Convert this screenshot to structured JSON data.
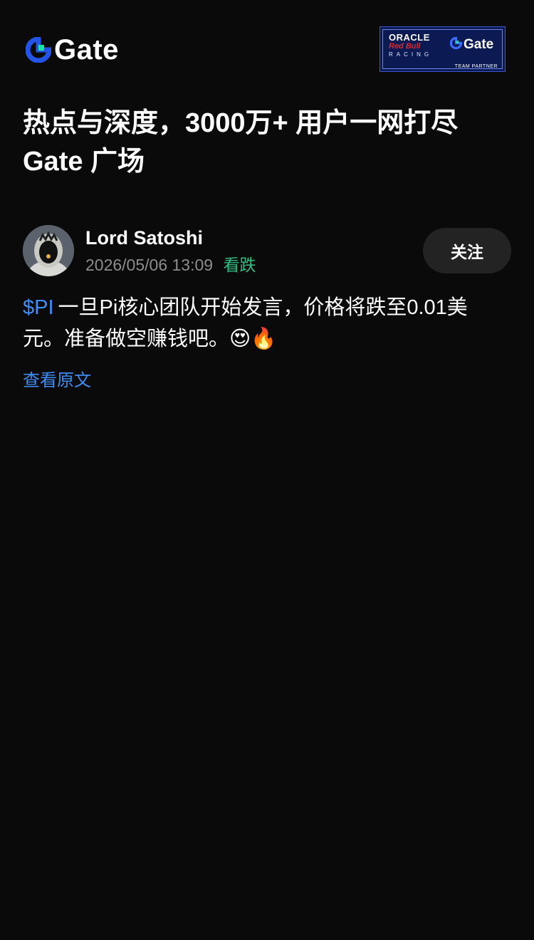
{
  "header": {
    "logo_text": "Gate",
    "partner_badge": {
      "oracle": "ORACLE",
      "redbull": "Red Bull",
      "racing": "RACING",
      "gate": "Gate",
      "team_partner": "TEAM PARTNER"
    }
  },
  "page_title": "热点与深度，3000万+ 用户一网打尽 Gate 广场",
  "post": {
    "author": "Lord Satoshi",
    "timestamp": "2026/05/06 13:09",
    "sentiment": "看跌",
    "follow_label": "关注",
    "ticker": "$PI",
    "body": "一旦Pi核心团队开始发言，价格将跌至0.01美元。准备做空赚钱吧。😍🔥",
    "view_original": "查看原文"
  },
  "colors": {
    "background": "#0a0a0a",
    "brand_blue": "#3d8df5",
    "bearish_green": "#2ebd85",
    "muted_text": "#8d8d8d",
    "button_bg": "#232323"
  },
  "icons": {
    "logo": "gate-logo-icon",
    "avatar": "avatar"
  }
}
